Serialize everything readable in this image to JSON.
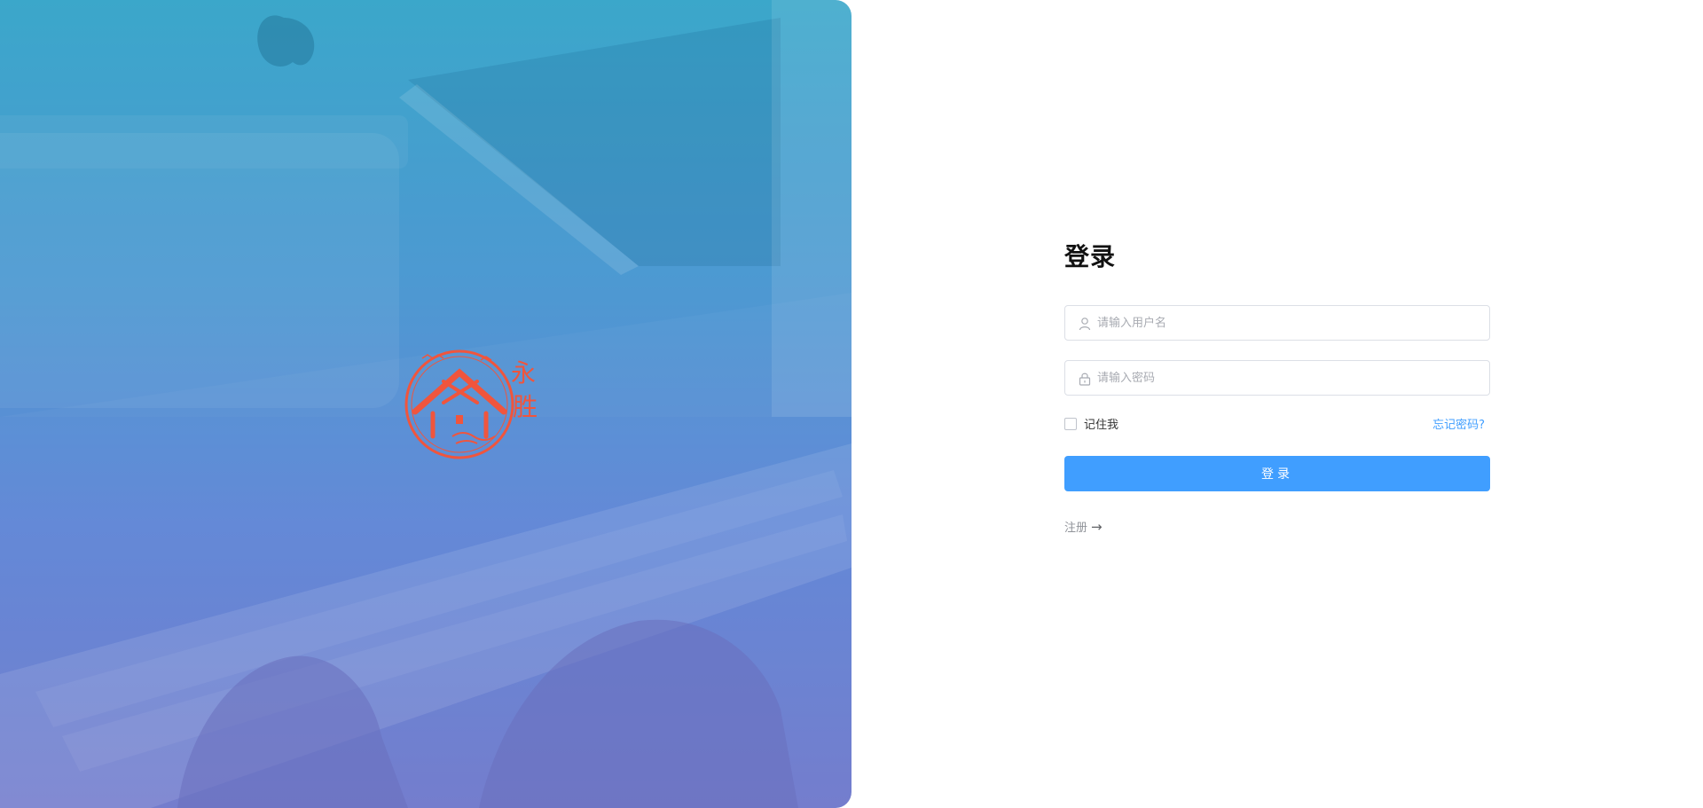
{
  "brand": {
    "logo_text_1": "永",
    "logo_text_2": "胜"
  },
  "login": {
    "title": "登录",
    "username_placeholder": "请输入用户名",
    "password_placeholder": "请输入密码",
    "remember_label": "记住我",
    "forgot_link": "忘记密码?",
    "submit_label": "登录",
    "register_link": "注册",
    "register_arrow": "→"
  },
  "icons": {
    "username": "user-icon",
    "password": "lock-icon",
    "remember": "checkbox-icon",
    "brand": "house-seal-logo"
  },
  "colors": {
    "accent": "#409eff",
    "logo": "#f0553d",
    "hero_top": "#38a6c9",
    "hero_bottom": "#7079cc"
  }
}
